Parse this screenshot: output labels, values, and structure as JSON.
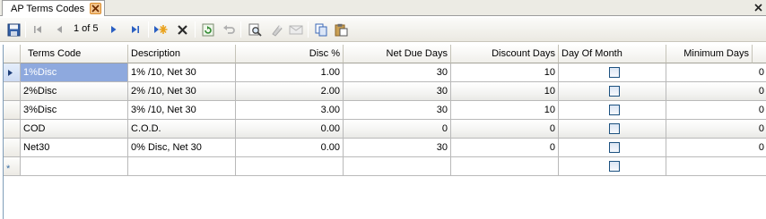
{
  "tab": {
    "label": "AP Terms Codes"
  },
  "toolbar": {
    "position_text": "1 of 5",
    "icons": [
      "save-icon",
      "first-record-icon",
      "previous-record-icon",
      "next-record-icon",
      "last-record-icon",
      "add-new-icon",
      "delete-icon",
      "refresh-icon",
      "undo-icon",
      "find-icon",
      "filter-icon",
      "email-icon",
      "copy-icon",
      "paste-icon"
    ]
  },
  "grid": {
    "columns": [
      "Terms Code",
      "Description",
      "Disc %",
      "Net Due Days",
      "Discount Days",
      "Day Of Month",
      "Minimum Days"
    ],
    "rows": [
      {
        "terms_code": "1%Disc",
        "description": "1% /10, Net 30",
        "disc": "1.00",
        "net_due_days": "30",
        "discount_days": "10",
        "day_of_month": false,
        "minimum_days": "0"
      },
      {
        "terms_code": "2%Disc",
        "description": "2% /10, Net 30",
        "disc": "2.00",
        "net_due_days": "30",
        "discount_days": "10",
        "day_of_month": false,
        "minimum_days": "0"
      },
      {
        "terms_code": "3%Disc",
        "description": "3% /10, Net 30",
        "disc": "3.00",
        "net_due_days": "30",
        "discount_days": "10",
        "day_of_month": false,
        "minimum_days": "0"
      },
      {
        "terms_code": "COD",
        "description": "C.O.D.",
        "disc": "0.00",
        "net_due_days": "0",
        "discount_days": "0",
        "day_of_month": false,
        "minimum_days": "0"
      },
      {
        "terms_code": "Net30",
        "description": "0% Disc, Net 30",
        "disc": "0.00",
        "net_due_days": "30",
        "discount_days": "0",
        "day_of_month": false,
        "minimum_days": "0"
      }
    ],
    "selected_row": 0,
    "new_row_marker": "*"
  },
  "colors": {
    "selection": "#8ea9de",
    "grid_line": "#b9b9b9",
    "tab_close": "#f3c48a"
  }
}
